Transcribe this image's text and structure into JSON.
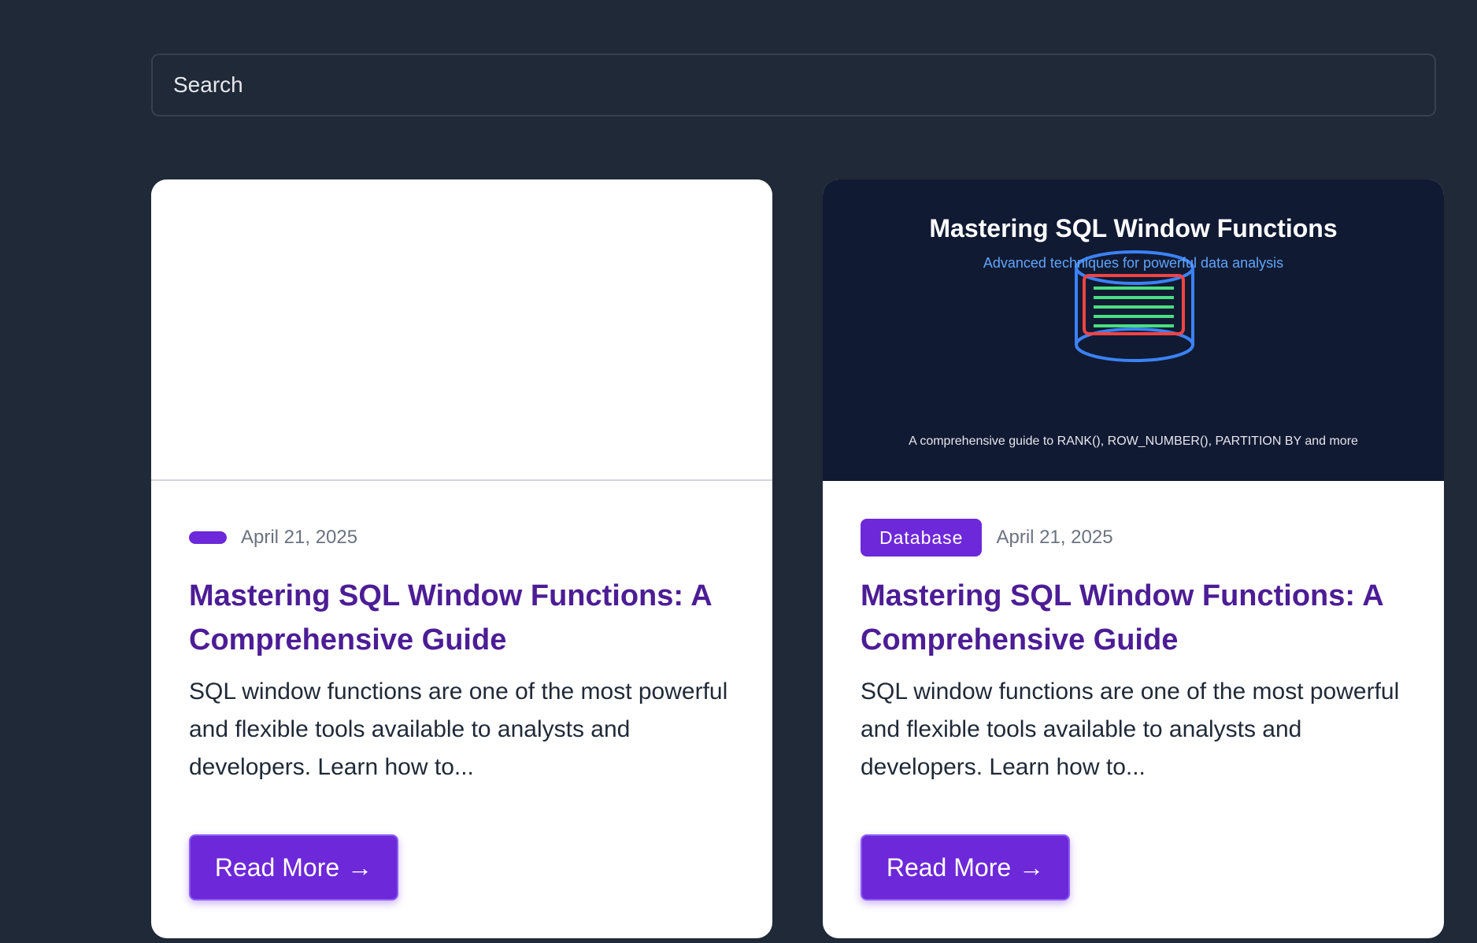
{
  "search": {
    "placeholder": "Search"
  },
  "posts": [
    {
      "category": "",
      "date": "April 21, 2025",
      "title": "Mastering SQL Window Functions: A Comprehensive Guide",
      "excerpt": "SQL window functions are one of the most powerful and flexible tools available to analysts and developers. Learn how to...",
      "cta": "Read More",
      "cta_icon": "arrow-right-icon"
    },
    {
      "category": "Database",
      "date": "April 21, 2025",
      "title": "Mastering SQL Window Functions: A Comprehensive Guide",
      "excerpt": "SQL window functions are one of the most powerful and flexible tools available to analysts and developers. Learn how to...",
      "cta": "Read More",
      "cta_icon": "arrow-right-icon",
      "thumbnail": {
        "title": "Mastering SQL Window Functions",
        "subtitle": "Advanced techniques for powerful data analysis",
        "caption": "A comprehensive guide to RANK(), ROW_NUMBER(), PARTITION BY and more"
      }
    }
  ],
  "colors": {
    "page_bg": "#1f2937",
    "accent": "#6d28d9",
    "title": "#4c1d95",
    "thumb_bg": "#111a33"
  }
}
